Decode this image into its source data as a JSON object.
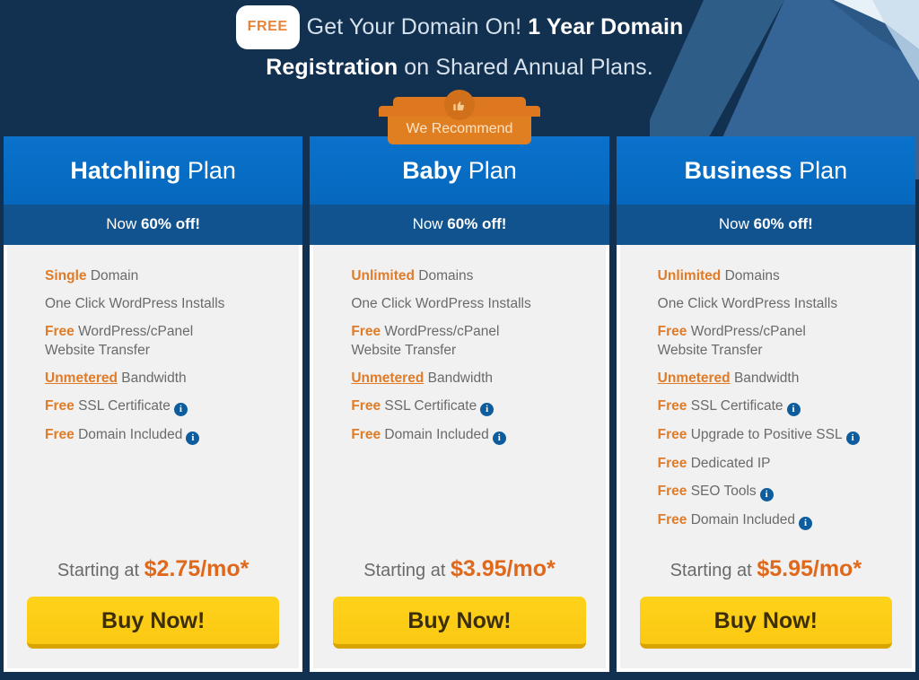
{
  "promo": {
    "badge": "FREE",
    "line1_light": "Get Your Domain On!",
    "line1_strong": "1 Year Domain",
    "line2_strong": "Registration",
    "line2_light": "on Shared Annual Plans."
  },
  "ribbon": {
    "label": "We Recommend",
    "icon": "thumbs-up-icon",
    "glyph": "👍"
  },
  "colors": {
    "page_bg": "#123050",
    "header_blue": "#0a6cc4",
    "discount_blue": "#11538e",
    "accent_orange": "#e07b28",
    "price_orange": "#e0681b",
    "button_yellow": "#ffd21a",
    "card_bg": "#f1f1f1",
    "info_icon_blue": "#0d5d9e"
  },
  "plans": [
    {
      "name": "Hatchling",
      "name_suffix": "Plan",
      "discount_prefix": "Now",
      "discount_value": "60% off!",
      "features": [
        {
          "hl": "Single",
          "hl_underline": false,
          "text": "Domain",
          "info": false
        },
        {
          "hl": "",
          "hl_underline": false,
          "text": "One Click WordPress Installs",
          "info": false
        },
        {
          "hl": "Free",
          "hl_underline": false,
          "text": "WordPress/cPanel Website Transfer",
          "info": false
        },
        {
          "hl": "Unmetered",
          "hl_underline": true,
          "text": "Bandwidth",
          "info": false
        },
        {
          "hl": "Free",
          "hl_underline": false,
          "text": "SSL Certificate",
          "info": true
        },
        {
          "hl": "Free",
          "hl_underline": false,
          "text": "Domain Included",
          "info": true
        }
      ],
      "price_prefix": "Starting at",
      "price": "$2.75/mo*",
      "buy_label": "Buy Now!",
      "recommended": false
    },
    {
      "name": "Baby",
      "name_suffix": "Plan",
      "discount_prefix": "Now",
      "discount_value": "60% off!",
      "features": [
        {
          "hl": "Unlimited",
          "hl_underline": false,
          "text": "Domains",
          "info": false
        },
        {
          "hl": "",
          "hl_underline": false,
          "text": "One Click WordPress Installs",
          "info": false
        },
        {
          "hl": "Free",
          "hl_underline": false,
          "text": "WordPress/cPanel Website Transfer",
          "info": false
        },
        {
          "hl": "Unmetered",
          "hl_underline": true,
          "text": "Bandwidth",
          "info": false
        },
        {
          "hl": "Free",
          "hl_underline": false,
          "text": "SSL Certificate",
          "info": true
        },
        {
          "hl": "Free",
          "hl_underline": false,
          "text": "Domain Included",
          "info": true
        }
      ],
      "price_prefix": "Starting at",
      "price": "$3.95/mo*",
      "buy_label": "Buy Now!",
      "recommended": true
    },
    {
      "name": "Business",
      "name_suffix": "Plan",
      "discount_prefix": "Now",
      "discount_value": "60% off!",
      "features": [
        {
          "hl": "Unlimited",
          "hl_underline": false,
          "text": "Domains",
          "info": false
        },
        {
          "hl": "",
          "hl_underline": false,
          "text": "One Click WordPress Installs",
          "info": false
        },
        {
          "hl": "Free",
          "hl_underline": false,
          "text": "WordPress/cPanel Website Transfer",
          "info": false
        },
        {
          "hl": "Unmetered",
          "hl_underline": true,
          "text": "Bandwidth",
          "info": false
        },
        {
          "hl": "Free",
          "hl_underline": false,
          "text": "SSL Certificate",
          "info": true
        },
        {
          "hl": "Free",
          "hl_underline": false,
          "text": "Upgrade to Positive SSL",
          "info": true
        },
        {
          "hl": "Free",
          "hl_underline": false,
          "text": "Dedicated IP",
          "info": false
        },
        {
          "hl": "Free",
          "hl_underline": false,
          "text": "SEO Tools",
          "info": true
        },
        {
          "hl": "Free",
          "hl_underline": false,
          "text": "Domain Included",
          "info": true
        }
      ],
      "price_prefix": "Starting at",
      "price": "$5.95/mo*",
      "buy_label": "Buy Now!",
      "recommended": false
    }
  ]
}
